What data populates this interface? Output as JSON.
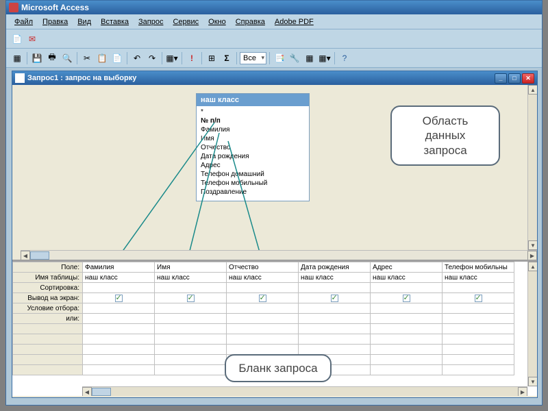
{
  "app": {
    "title": "Microsoft Access"
  },
  "menu": {
    "items": [
      "Файл",
      "Правка",
      "Вид",
      "Вставка",
      "Запрос",
      "Сервис",
      "Окно",
      "Справка",
      "Adobe PDF"
    ]
  },
  "toolbar2": {
    "combo1": "Все"
  },
  "subwindow": {
    "title": "Запрос1 : запрос на выборку"
  },
  "field_list": {
    "title": "наш класс",
    "items": [
      "*",
      "№ п/п",
      "Фамилия",
      "Имя",
      "Отчество",
      "Дата рождения",
      "Адрес",
      "Телефон домашний",
      "Телефон мобильный",
      "Поздравление"
    ]
  },
  "callouts": {
    "c1_line1": "Область",
    "c1_line2": "данных",
    "c1_line3": "запроса",
    "c2": "Бланк запроса"
  },
  "grid": {
    "row_labels": [
      "Поле:",
      "Имя таблицы:",
      "Сортировка:",
      "Вывод на экран:",
      "Условие отбора:",
      "или:"
    ],
    "columns": [
      {
        "field": "Фамилия",
        "table": "наш класс",
        "show": true
      },
      {
        "field": "Имя",
        "table": "наш класс",
        "show": true
      },
      {
        "field": "Отчество",
        "table": "наш класс",
        "show": true
      },
      {
        "field": "Дата рождения",
        "table": "наш класс",
        "show": true
      },
      {
        "field": "Адрес",
        "table": "наш класс",
        "show": true
      },
      {
        "field": "Телефон мобильны",
        "table": "наш класс",
        "show": true
      }
    ],
    "blank_after_rows": 5
  }
}
